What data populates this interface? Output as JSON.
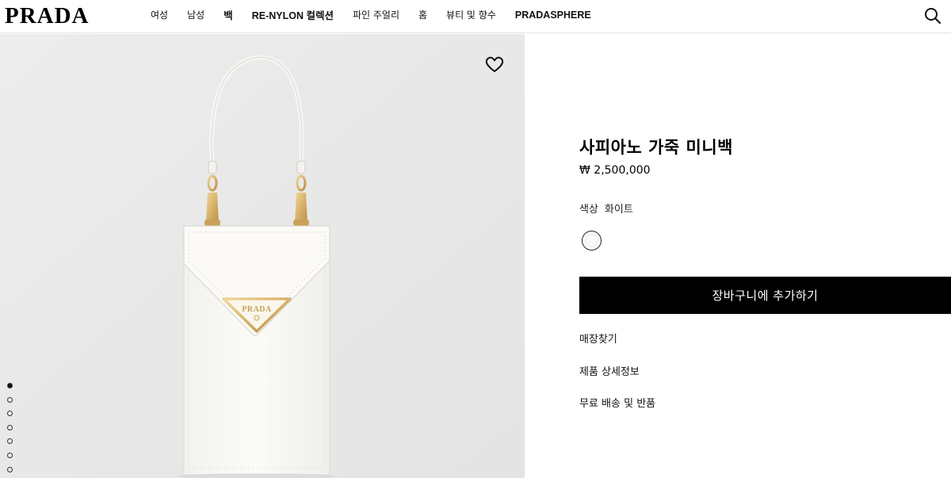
{
  "header": {
    "logo_text": "PRADA",
    "nav": [
      {
        "label": "여성",
        "bold": false
      },
      {
        "label": "남성",
        "bold": false
      },
      {
        "label": "백",
        "bold": true
      },
      {
        "label": "RE-NYLON 컬렉션",
        "bold": false
      },
      {
        "label": "파인 주얼리",
        "bold": false
      },
      {
        "label": "홈",
        "bold": false
      },
      {
        "label": "뷰티 및 향수",
        "bold": false
      },
      {
        "label": "PRADASPHERE",
        "bold": false
      }
    ]
  },
  "gallery": {
    "image_count": 7,
    "active_index": 0,
    "plaque_text": "PRADA"
  },
  "product": {
    "title": "사피아노 가죽 미니백",
    "price": "₩ 2,500,000",
    "color_label": "색상",
    "color_value": "화이트",
    "add_to_cart_label": "장바구니에 추가하기",
    "links": {
      "store_finder": "매장찾기",
      "details": "제품 상세정보",
      "shipping_returns": "무료 배송 및 반품"
    }
  },
  "colors": {
    "gallery_bg": "#e9e9e9",
    "bag": "#fafaf7",
    "gold": "#d8b26a",
    "button_bg": "#000000"
  }
}
